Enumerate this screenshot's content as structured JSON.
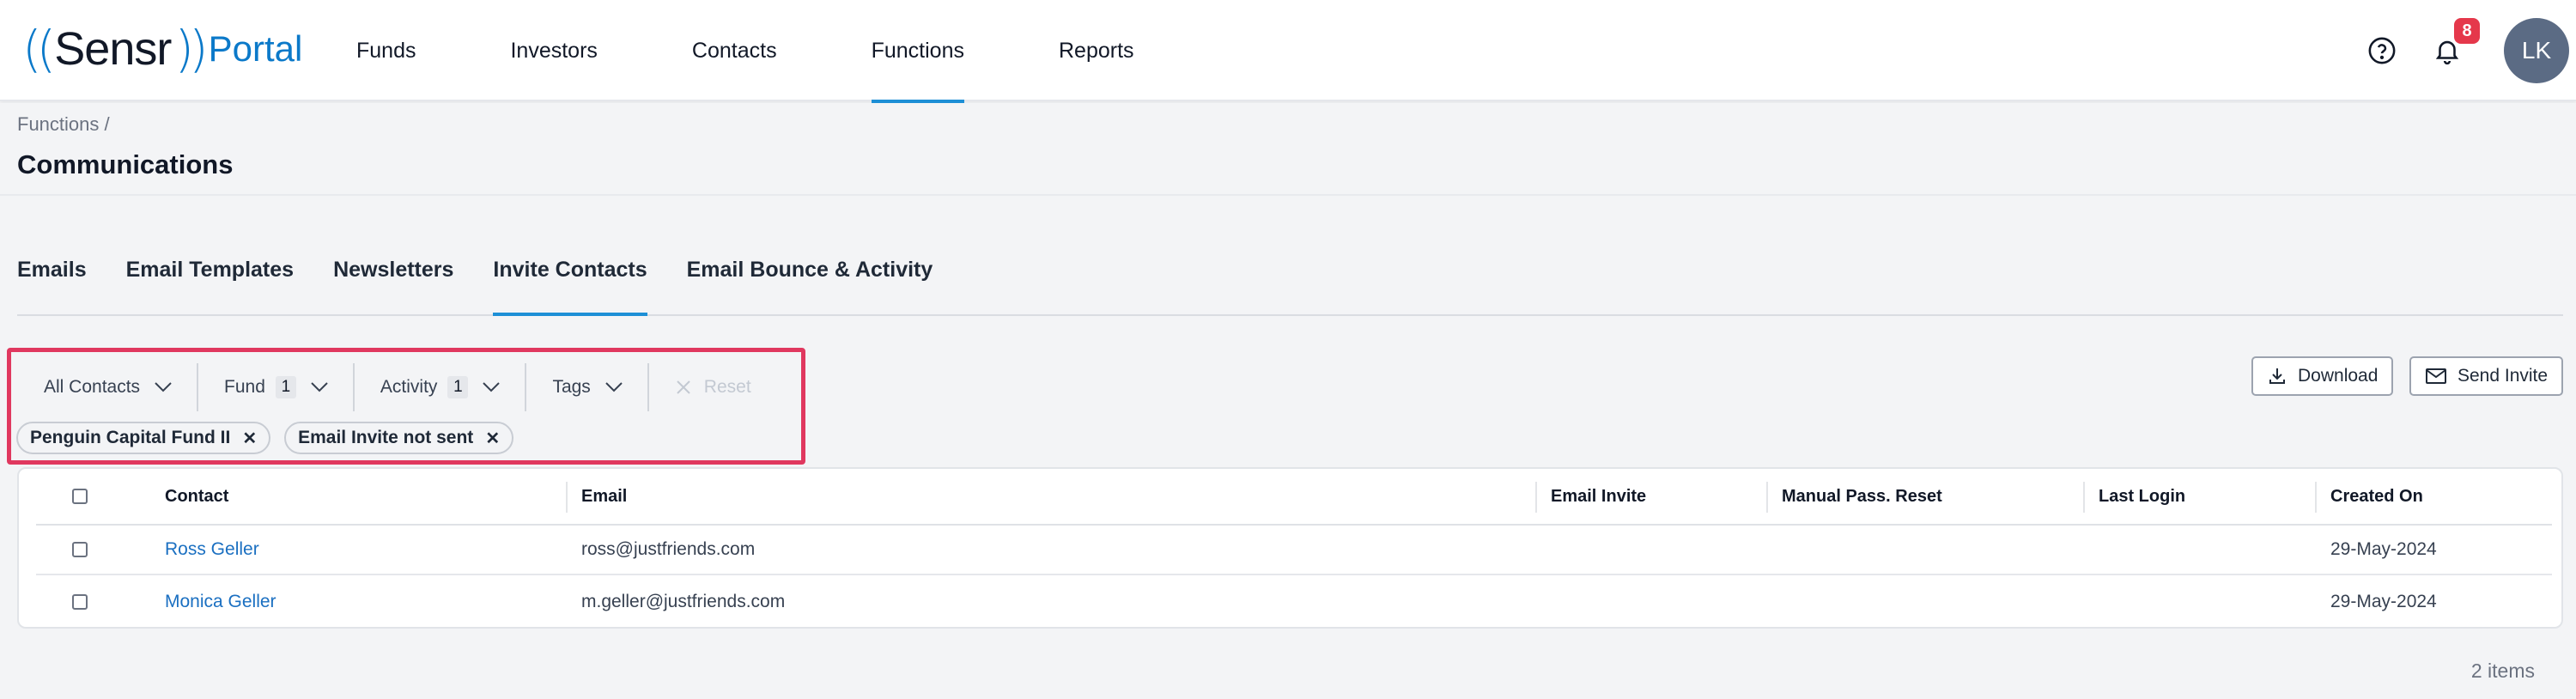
{
  "app": {
    "brand": "Sensr",
    "brand_suffix": "Portal"
  },
  "nav": {
    "items": [
      {
        "label": "Funds"
      },
      {
        "label": "Investors"
      },
      {
        "label": "Contacts"
      },
      {
        "label": "Functions",
        "active": true
      },
      {
        "label": "Reports"
      }
    ],
    "notifications_count": "8",
    "user_initials": "LK"
  },
  "page": {
    "breadcrumb": "Functions /",
    "title": "Communications"
  },
  "tabs": [
    {
      "label": "Emails"
    },
    {
      "label": "Email Templates"
    },
    {
      "label": "Newsletters"
    },
    {
      "label": "Invite Contacts",
      "active": true
    },
    {
      "label": "Email Bounce & Activity"
    }
  ],
  "filters": {
    "all_contacts": "All Contacts",
    "fund": "Fund",
    "fund_count": "1",
    "activity": "Activity",
    "activity_count": "1",
    "tags": "Tags",
    "reset": "Reset",
    "chips": [
      "Penguin Capital Fund II",
      "Email Invite not sent"
    ]
  },
  "actions": {
    "download": "Download",
    "send_invite": "Send Invite"
  },
  "table": {
    "columns": [
      "Contact",
      "Email",
      "Email Invite",
      "Manual Pass. Reset",
      "Last Login",
      "Created On"
    ],
    "rows": [
      {
        "contact": "Ross Geller",
        "email": "ross@justfriends.com",
        "email_invite": "",
        "manual_reset": "",
        "last_login": "",
        "created_on": "29-May-2024"
      },
      {
        "contact": "Monica Geller",
        "email": "m.geller@justfriends.com",
        "email_invite": "",
        "manual_reset": "",
        "last_login": "",
        "created_on": "29-May-2024"
      }
    ],
    "count_label": "2 items"
  },
  "colors": {
    "accent": "#1d8fd6",
    "highlight_border": "#e0385f",
    "badge": "#e5384b",
    "link": "#1a6fc1"
  }
}
